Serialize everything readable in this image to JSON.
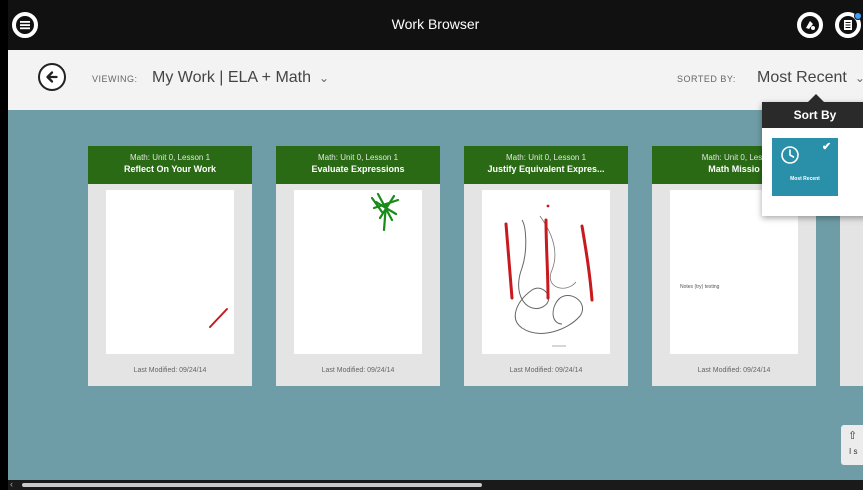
{
  "topbar": {
    "title": "Work Browser"
  },
  "viewbar": {
    "viewing_label": "VIEWING:",
    "viewing_value": "My Work | ELA + Math",
    "sorted_label": "SORTED BY:",
    "sorted_value": "Most Recent"
  },
  "cards": [
    {
      "subtitle": "Math: Unit 0, Lesson 1",
      "title": "Reflect On Your Work",
      "footer": "Last Modified: 09/24/14"
    },
    {
      "subtitle": "Math: Unit 0, Lesson 1",
      "title": "Evaluate Expressions",
      "footer": "Last Modified: 09/24/14"
    },
    {
      "subtitle": "Math: Unit 0, Lesson 1",
      "title": "Justify Equivalent Expres...",
      "footer": "Last Modified: 09/24/14"
    },
    {
      "subtitle": "Math: Unit 0, Less",
      "title": "Math Missio",
      "footer": "Last Modified: 09/24/14",
      "note": "Notes (try) texting"
    }
  ],
  "sort_popover": {
    "title": "Sort By",
    "option_label": "Most Recent"
  },
  "share_tab": {
    "text": "I s"
  },
  "colors": {
    "topbar": "#111111",
    "card_header": "#2a6a15",
    "main_bg": "#6f9da7",
    "sort_option": "#2a8fa8"
  }
}
